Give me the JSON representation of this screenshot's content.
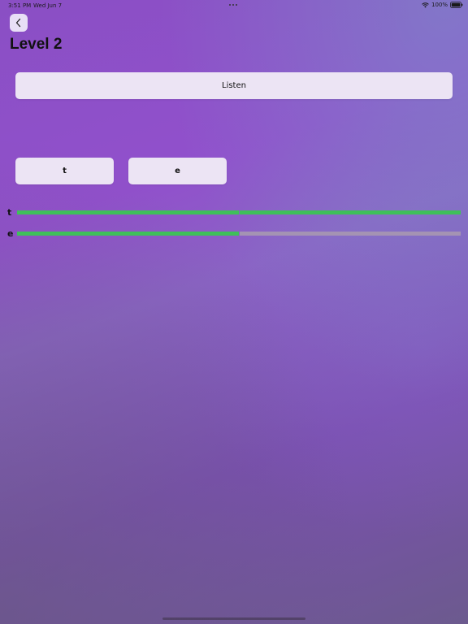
{
  "status_bar": {
    "time": "3:51 PM",
    "date": "Wed Jun 7",
    "battery": "100%"
  },
  "header": {
    "title": "Level 2",
    "back_icon": "chevron-left-icon"
  },
  "listen_button": {
    "label": "Listen"
  },
  "letter_buttons": [
    {
      "label": "t"
    },
    {
      "label": "e"
    }
  ],
  "progress": [
    {
      "letter": "t",
      "segments": [
        true,
        true
      ],
      "fraction": 1.0
    },
    {
      "letter": "e",
      "segments": [
        true,
        false
      ],
      "fraction": 0.5
    }
  ],
  "colors": {
    "progress_filled": "#3fbf5a",
    "progress_empty": "#a493b3",
    "button_bg": "#ece4f4"
  }
}
